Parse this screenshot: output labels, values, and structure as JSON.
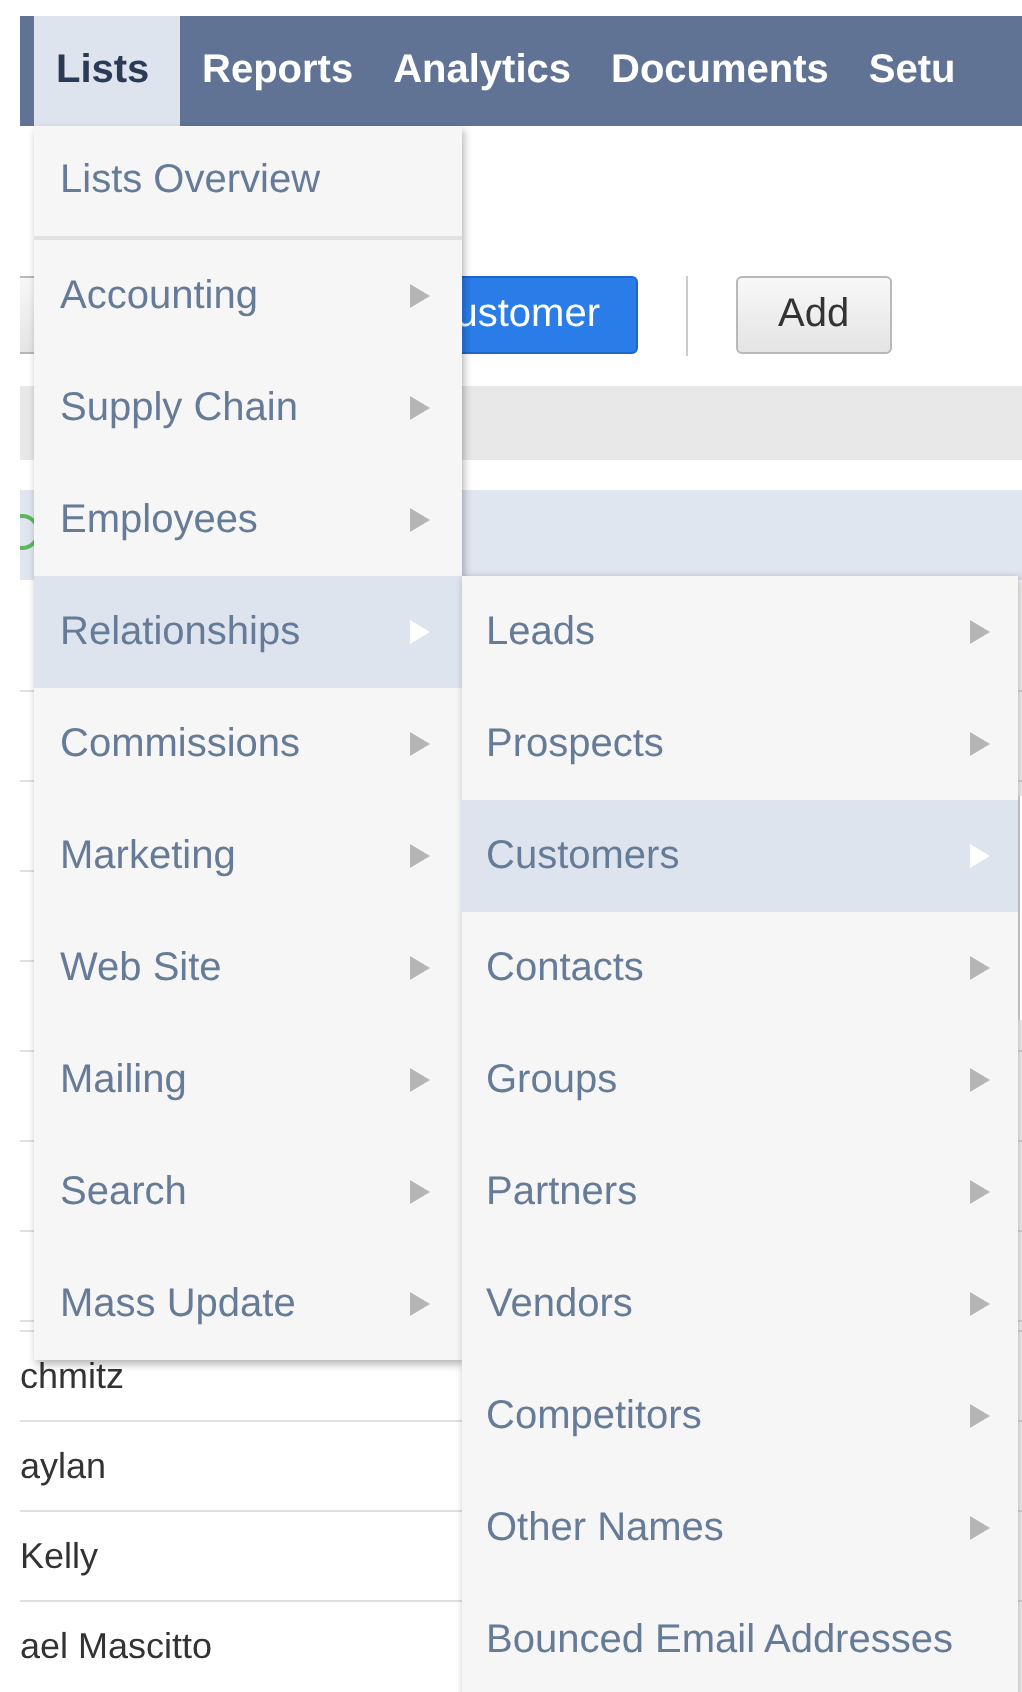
{
  "nav": {
    "tabs": [
      {
        "label": "Lists",
        "selected": true
      },
      {
        "label": "Reports",
        "selected": false
      },
      {
        "label": "Analytics",
        "selected": false
      },
      {
        "label": "Documents",
        "selected": false
      },
      {
        "label": "Setu",
        "selected": false
      }
    ]
  },
  "page": {
    "buttons": [
      {
        "label": "ustomer",
        "kind": "primary"
      },
      {
        "label": "Add",
        "kind": "plain"
      }
    ],
    "rows": [
      "chmitz",
      "aylan",
      "Kelly",
      "ael Mascitto"
    ]
  },
  "menu": {
    "items": [
      {
        "label": "Lists Overview",
        "submenu": false,
        "selected": false
      },
      {
        "label": "Accounting",
        "submenu": true,
        "selected": false
      },
      {
        "label": "Supply Chain",
        "submenu": true,
        "selected": false
      },
      {
        "label": "Employees",
        "submenu": true,
        "selected": false
      },
      {
        "label": "Relationships",
        "submenu": true,
        "selected": true
      },
      {
        "label": "Commissions",
        "submenu": true,
        "selected": false
      },
      {
        "label": "Marketing",
        "submenu": true,
        "selected": false
      },
      {
        "label": "Web Site",
        "submenu": true,
        "selected": false
      },
      {
        "label": "Mailing",
        "submenu": true,
        "selected": false
      },
      {
        "label": "Search",
        "submenu": true,
        "selected": false
      },
      {
        "label": "Mass Update",
        "submenu": true,
        "selected": false
      }
    ]
  },
  "submenu": {
    "items": [
      {
        "label": "Leads",
        "submenu": true,
        "selected": false
      },
      {
        "label": "Prospects",
        "submenu": true,
        "selected": false
      },
      {
        "label": "Customers",
        "submenu": true,
        "selected": true
      },
      {
        "label": "Contacts",
        "submenu": true,
        "selected": false
      },
      {
        "label": "Groups",
        "submenu": true,
        "selected": false
      },
      {
        "label": "Partners",
        "submenu": true,
        "selected": false
      },
      {
        "label": "Vendors",
        "submenu": true,
        "selected": false
      },
      {
        "label": "Competitors",
        "submenu": true,
        "selected": false
      },
      {
        "label": "Other Names",
        "submenu": true,
        "selected": false
      },
      {
        "label": "Bounced Email Addresses",
        "submenu": false,
        "selected": false
      }
    ]
  }
}
